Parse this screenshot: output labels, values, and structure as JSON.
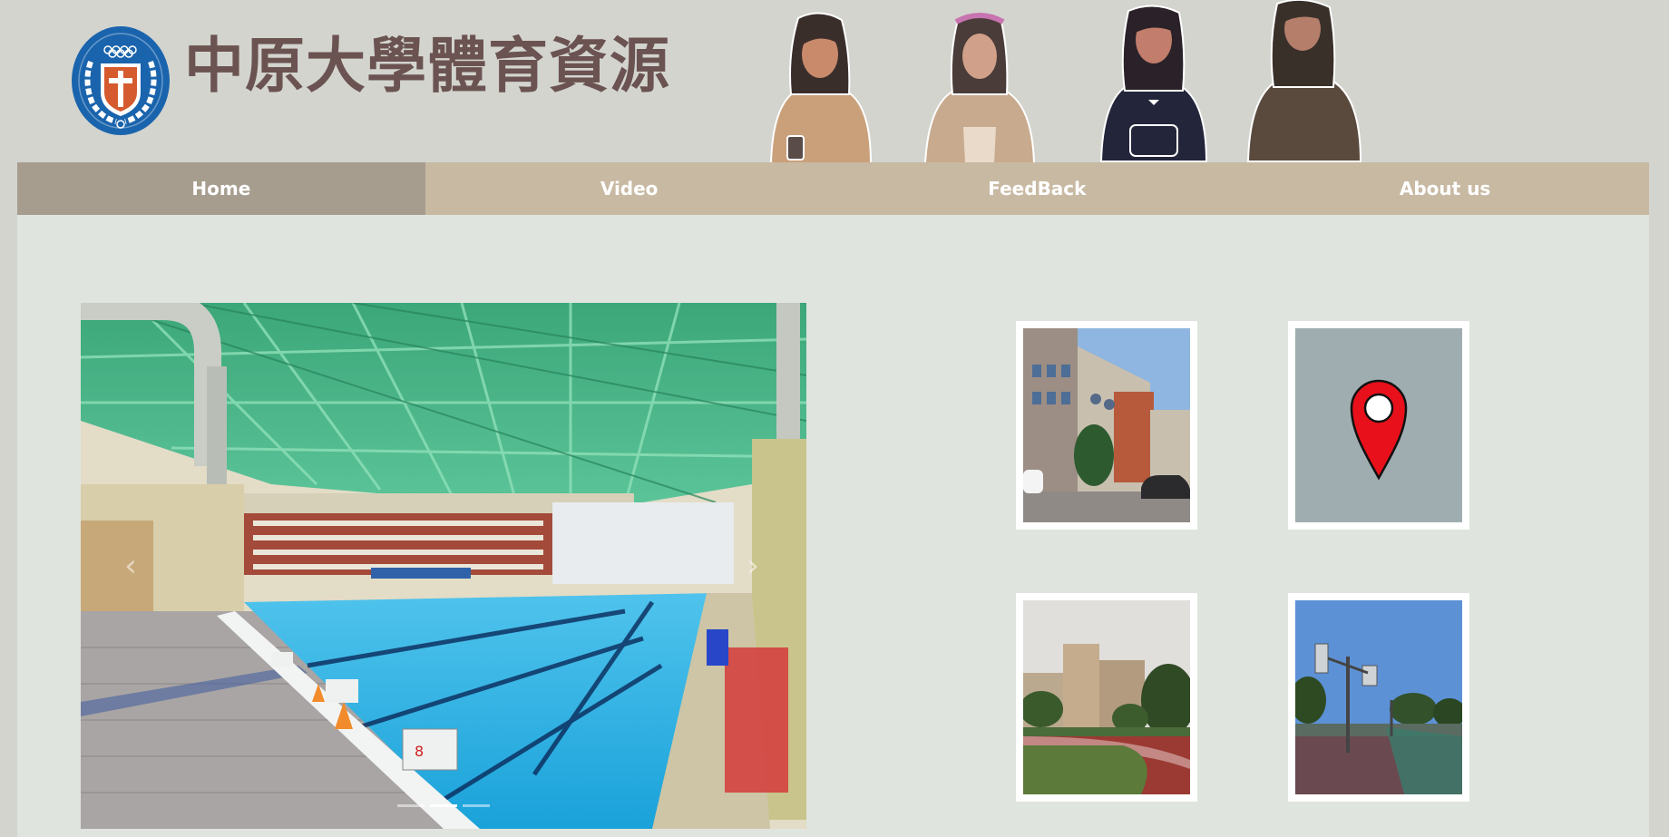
{
  "header": {
    "title": "中原大學體育資源",
    "logo_icon": "university-emblem-icon"
  },
  "nav": {
    "items": [
      {
        "label": "Home",
        "active": true
      },
      {
        "label": "Video",
        "active": false
      },
      {
        "label": "FeedBack",
        "active": false
      },
      {
        "label": "About us",
        "active": false
      }
    ]
  },
  "carousel": {
    "prev_icon": "chevron-left-icon",
    "next_icon": "chevron-right-icon",
    "prev_glyph": "‹",
    "next_glyph": "›",
    "slide_count": 3,
    "active_index": 1
  },
  "tiles": [
    {
      "icon": "building-photo-icon"
    },
    {
      "icon": "map-pin-icon"
    },
    {
      "icon": "track-field-photo-icon"
    },
    {
      "icon": "basketball-court-photo-icon"
    }
  ],
  "colors": {
    "page_bg": "#d3d4ce",
    "nav_bg": "#c8b9a3",
    "nav_active_bg": "#a79d8f",
    "main_bg": "#e0e4de",
    "title_color": "#6b5352",
    "pin_color": "#e8101a"
  }
}
